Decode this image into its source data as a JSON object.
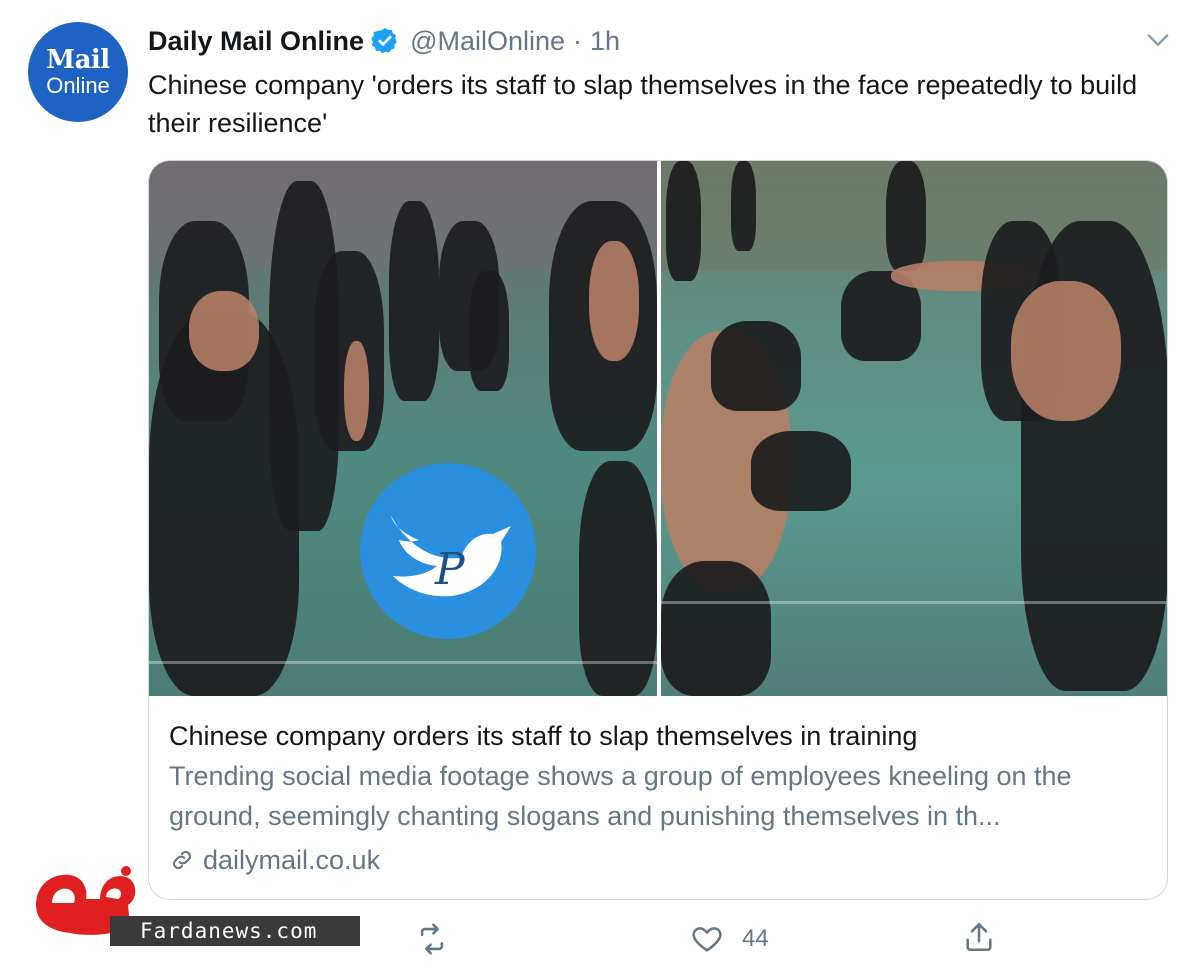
{
  "account": {
    "avatar_line1": "Mail",
    "avatar_line2": "Online",
    "name": "Daily Mail Online",
    "handle": "@MailOnline",
    "separator": "·",
    "time": "1h"
  },
  "tweet": {
    "text": "Chinese company 'orders its staff to slap themselves in the face repeatedly to build their resilience'"
  },
  "card": {
    "title": "Chinese company orders its staff to slap themselves in training",
    "description": "Trending social media footage shows a group of employees kneeling on the ground, seemingly chanting slogans and punishing themselves in th...",
    "domain": "dailymail.co.uk"
  },
  "actions": {
    "reply_count": "",
    "retweet_count": "",
    "like_count": "44",
    "share_count": ""
  },
  "watermark": {
    "site": "Fardanews.com",
    "logo_text": "فردا"
  },
  "icons": {
    "verified": "verified-badge-icon",
    "more": "chevron-down-icon",
    "link": "link-icon",
    "retweet": "retweet-icon",
    "like": "heart-icon",
    "share": "share-icon"
  },
  "colors": {
    "avatar_bg": "#1e63c4",
    "verified": "#1da1f2",
    "secondary_text": "#657786",
    "watermark_red": "#e02020",
    "watermark_bar": "#3a3a3a"
  }
}
